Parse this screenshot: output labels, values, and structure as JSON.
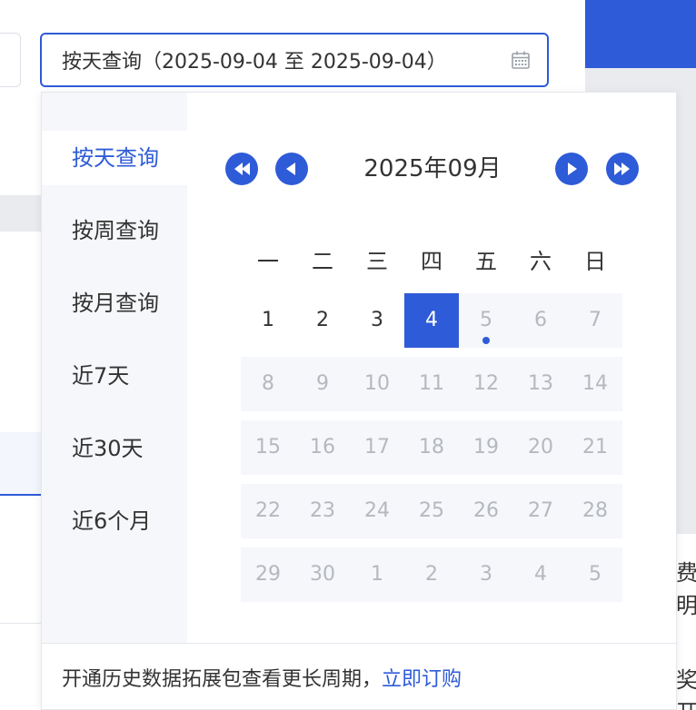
{
  "date_input": {
    "text": "按天查询（2025-09-04 至 2025-09-04）",
    "icon": "calendar-icon"
  },
  "shortcuts": [
    {
      "label": "按天查询",
      "active": true
    },
    {
      "label": "按周查询",
      "active": false
    },
    {
      "label": "按月查询",
      "active": false
    },
    {
      "label": "近7天",
      "active": false
    },
    {
      "label": "近30天",
      "active": false
    },
    {
      "label": "近6个月",
      "active": false
    }
  ],
  "calendar": {
    "title": "2025年09月",
    "weekdays": [
      "一",
      "二",
      "三",
      "四",
      "五",
      "六",
      "日"
    ],
    "weeks": [
      [
        {
          "d": "1",
          "s": "avail"
        },
        {
          "d": "2",
          "s": "avail"
        },
        {
          "d": "3",
          "s": "avail"
        },
        {
          "d": "4",
          "s": "selected"
        },
        {
          "d": "5",
          "s": "disabled",
          "today": true
        },
        {
          "d": "6",
          "s": "disabled"
        },
        {
          "d": "7",
          "s": "disabled"
        }
      ],
      [
        {
          "d": "8",
          "s": "disabled"
        },
        {
          "d": "9",
          "s": "disabled"
        },
        {
          "d": "10",
          "s": "disabled"
        },
        {
          "d": "11",
          "s": "disabled"
        },
        {
          "d": "12",
          "s": "disabled"
        },
        {
          "d": "13",
          "s": "disabled"
        },
        {
          "d": "14",
          "s": "disabled"
        }
      ],
      [
        {
          "d": "15",
          "s": "disabled"
        },
        {
          "d": "16",
          "s": "disabled"
        },
        {
          "d": "17",
          "s": "disabled"
        },
        {
          "d": "18",
          "s": "disabled"
        },
        {
          "d": "19",
          "s": "disabled"
        },
        {
          "d": "20",
          "s": "disabled"
        },
        {
          "d": "21",
          "s": "disabled"
        }
      ],
      [
        {
          "d": "22",
          "s": "disabled"
        },
        {
          "d": "23",
          "s": "disabled"
        },
        {
          "d": "24",
          "s": "disabled"
        },
        {
          "d": "25",
          "s": "disabled"
        },
        {
          "d": "26",
          "s": "disabled"
        },
        {
          "d": "27",
          "s": "disabled"
        },
        {
          "d": "28",
          "s": "disabled"
        }
      ],
      [
        {
          "d": "29",
          "s": "disabled"
        },
        {
          "d": "30",
          "s": "disabled"
        },
        {
          "d": "1",
          "s": "disabled"
        },
        {
          "d": "2",
          "s": "disabled"
        },
        {
          "d": "3",
          "s": "disabled"
        },
        {
          "d": "4",
          "s": "disabled"
        },
        {
          "d": "5",
          "s": "disabled"
        }
      ]
    ]
  },
  "nav_icons": [
    "prev-year-icon",
    "prev-month-icon",
    "next-month-icon",
    "next-year-icon"
  ],
  "footer": {
    "text": "开通历史数据拓展包查看更长周期，",
    "link": "立即订购"
  },
  "background": {
    "right_text_1": "费",
    "right_text_2": "明",
    "right_text_3": "奖",
    "right_text_4": "开"
  },
  "colors": {
    "accent": "#2e5bd7",
    "disabled_bg": "#f5f7fa",
    "disabled_text": "#b5b8bf"
  }
}
